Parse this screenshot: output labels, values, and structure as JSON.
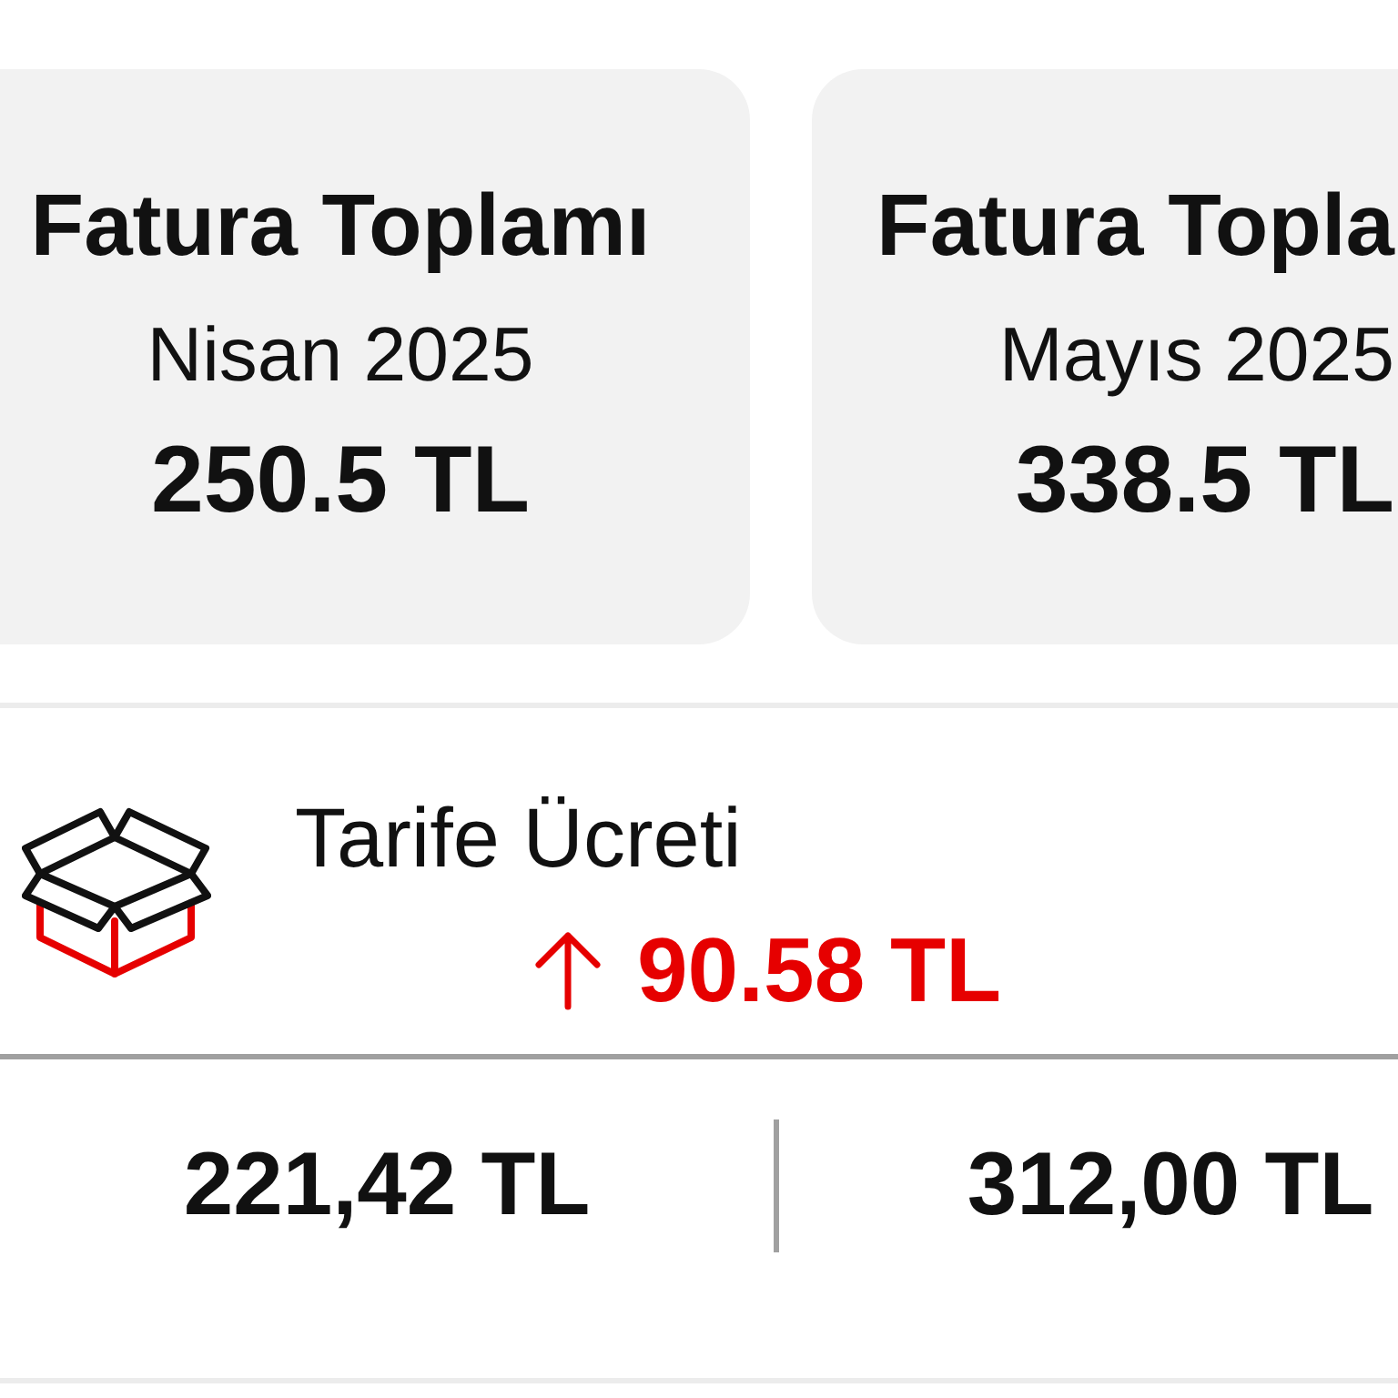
{
  "summary_cards": [
    {
      "title": "Fatura Toplamı",
      "period": "Nisan 2025",
      "total": "250.5 TL"
    },
    {
      "title": "Fatura Topla",
      "period": "Mayıs 2025",
      "total": "338.5 TL"
    }
  ],
  "charge": {
    "label": "Tarife Ücreti",
    "increased": true,
    "difference": "90.58 TL",
    "amounts": [
      "221,42 TL",
      "312,00 TL"
    ]
  }
}
